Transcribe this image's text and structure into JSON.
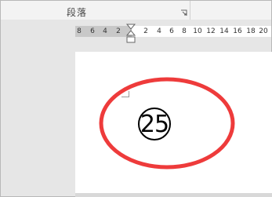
{
  "ribbon": {
    "group_label": "段落"
  },
  "ruler": {
    "ticks": [
      {
        "label": "8"
      },
      {
        "label": "6"
      },
      {
        "label": "4"
      },
      {
        "label": "2"
      },
      {
        "label": "2"
      },
      {
        "label": "4"
      },
      {
        "label": "6"
      },
      {
        "label": "8"
      },
      {
        "label": "10"
      },
      {
        "label": "12"
      },
      {
        "label": "14"
      },
      {
        "label": "16"
      },
      {
        "label": "18"
      },
      {
        "label": "20"
      }
    ]
  },
  "document": {
    "circled_number": "25"
  },
  "colors": {
    "highlight": "#ee3b3b"
  },
  "icons": {
    "launcher": "dialog-launcher-icon",
    "indent": "indent-marker-icon"
  }
}
